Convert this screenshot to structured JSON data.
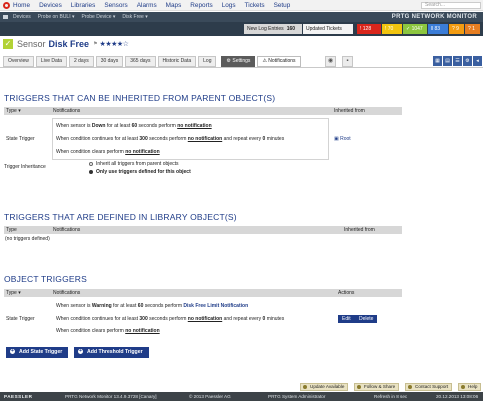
{
  "nav": {
    "items": [
      "Home",
      "Devices",
      "Libraries",
      "Sensors",
      "Alarms",
      "Maps",
      "Reports",
      "Logs",
      "Tickets",
      "Setup"
    ],
    "search_placeholder": "Search..."
  },
  "breadcrumb": {
    "items": [
      "Devices",
      "Probe on BULI ▾",
      "Probe Device ▾",
      "Disk Free ▾"
    ],
    "brand": "PRTG NETWORK MONITOR"
  },
  "status": {
    "log_label": "New Log Entries",
    "log_count": "160",
    "tickets_label": "Updated Tickets",
    "badges": [
      {
        "icon": "!",
        "value": "128",
        "color": "#d9261c"
      },
      {
        "icon": "!",
        "value": "70",
        "color": "#f1c40f"
      },
      {
        "icon": "✓",
        "value": "1047",
        "color": "#8cc63f"
      },
      {
        "icon": "ǁ",
        "value": "83",
        "color": "#3b7dd8"
      },
      {
        "icon": "?",
        "value": "9",
        "color": "#f39c12"
      },
      {
        "icon": "?",
        "value": "1",
        "color": "#e67e22"
      }
    ]
  },
  "sensor": {
    "type_label": "Sensor",
    "name": "Disk Free",
    "pin": "⚑",
    "stars": "★★★★☆"
  },
  "tabs": [
    "Overview",
    "Live Data",
    "2 days",
    "30 days",
    "365 days",
    "Historic Data",
    "Log",
    "⚙ Settings",
    "⚠ Notifications"
  ],
  "inherited": {
    "title": "TRIGGERS THAT CAN BE INHERITED FROM PARENT OBJECT(S)",
    "col_type": "Type ▾",
    "col_notifications": "Notifications",
    "col_inherited": "Inherited from",
    "row_label": "State Trigger",
    "line1": [
      "When sensor is ",
      "Down",
      " for at least ",
      "60",
      " seconds perform ",
      "no notification"
    ],
    "line2": [
      "When condition continues for at least ",
      "300",
      " seconds perform ",
      "no notification",
      " and repeat every ",
      "0",
      " minutes"
    ],
    "line3": [
      "When condition clears perform ",
      "no notification"
    ],
    "root_link": "Root",
    "inheritance_label": "Trigger Inheritance",
    "opt1": "Inherit all triggers from parent objects",
    "opt2": "Only use triggers defined for this object"
  },
  "library": {
    "title": "TRIGGERS THAT ARE DEFINED IN LIBRARY OBJECT(S)",
    "col_type": "Type",
    "col_notifications": "Notifications",
    "col_inherited": "Inherited from",
    "none": "(no triggers defined)"
  },
  "object": {
    "title": "OBJECT TRIGGERS",
    "col_type": "Type ▾",
    "col_notifications": "Notifications",
    "col_actions": "Actions",
    "row_label": "State Trigger",
    "line1": [
      "When sensor is ",
      "Warning",
      " for at least ",
      "60",
      " seconds perform ",
      "Disk Free Limit Notification"
    ],
    "line2": [
      "When condition continues for at least ",
      "300",
      " seconds perform ",
      "no notification",
      " and repeat every ",
      "0",
      " minutes"
    ],
    "line3": [
      "When condition clears perform ",
      "no notification"
    ],
    "edit": "Edit",
    "delete": "Delete",
    "add_state": "Add State Trigger",
    "add_threshold": "Add Threshold Trigger"
  },
  "footer": {
    "actions": [
      "Update Available",
      "Follow & Share",
      "Contact Support",
      "Help"
    ],
    "brand": "PAESSLER",
    "version": "PRTG Network Monitor 13.4.9.3728 [Canary]",
    "copyright": "© 2013 Paessler AG",
    "user": "PRTG System Administrator",
    "refresh": "Refresh in 8 sec",
    "datetime": "20.12.2013 13:08:06"
  }
}
